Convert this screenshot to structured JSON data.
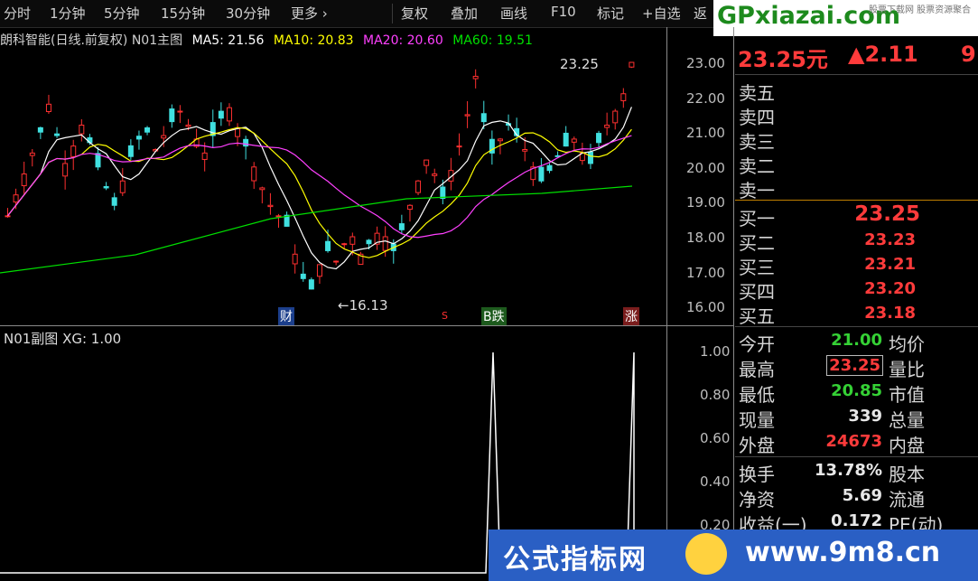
{
  "toolbar": {
    "items": [
      "分时",
      "1分钟",
      "5分钟",
      "15分钟",
      "30分钟",
      "更多 ›",
      "复权",
      "叠加",
      "画线",
      "F10",
      "标记",
      "+自选",
      "返"
    ]
  },
  "main_chart": {
    "title": "朗科智能(日线.前复权) N01主图",
    "ma5": "MA5: 21.56",
    "ma10": "MA10: 20.83",
    "ma20": "MA20: 20.60",
    "ma60": "MA60: 19.51",
    "y_ticks": [
      "23.00",
      "22.00",
      "21.00",
      "20.00",
      "19.00",
      "18.00",
      "17.00",
      "16.00"
    ],
    "high_label": "23.25",
    "low_label": "16.13",
    "tags": [
      "财",
      "S",
      "B跌",
      "涨"
    ],
    "colors": {
      "ma5": "#ffffff",
      "ma10": "#ffff00",
      "ma20": "#ff40ff",
      "ma60": "#00e000",
      "up": "#ff3030",
      "down": "#40e0e0"
    }
  },
  "sub_chart": {
    "title": "N01副图 XG: 1.00",
    "y_ticks": [
      "1.00",
      "0.80",
      "0.60",
      "0.40",
      "0.20"
    ]
  },
  "quote": {
    "price": "23.25元",
    "change": "▲2.11",
    "change_extra": "9",
    "sell_labels": [
      "卖五",
      "卖四",
      "卖三",
      "卖二",
      "卖一"
    ],
    "buy_labels": [
      "买一",
      "买二",
      "买三",
      "买四",
      "买五"
    ],
    "buy_prices": [
      "23.25",
      "23.23",
      "23.21",
      "23.20",
      "23.18"
    ],
    "stats": [
      {
        "label": "今开",
        "value": "21.00",
        "label2": "均价"
      },
      {
        "label": "最高",
        "value": "23.25",
        "label2": "量比"
      },
      {
        "label": "最低",
        "value": "20.85",
        "label2": "市值"
      },
      {
        "label": "现量",
        "value": "339",
        "label2": "总量"
      },
      {
        "label": "外盘",
        "value": "24673",
        "label2": "内盘"
      }
    ],
    "stats2": [
      {
        "label": "换手",
        "value": "13.78%",
        "label2": "股本"
      },
      {
        "label": "净资",
        "value": "5.69",
        "label2": "流通"
      },
      {
        "label": "收益(一)",
        "value": "0.172",
        "label2": "PE(动)"
      }
    ]
  },
  "logo": {
    "text": "GPxiazai.com",
    "sub": "股票下载网 股票资源聚合"
  },
  "banner": {
    "left": "公式指标网",
    "right": "www.9m8.cn"
  }
}
